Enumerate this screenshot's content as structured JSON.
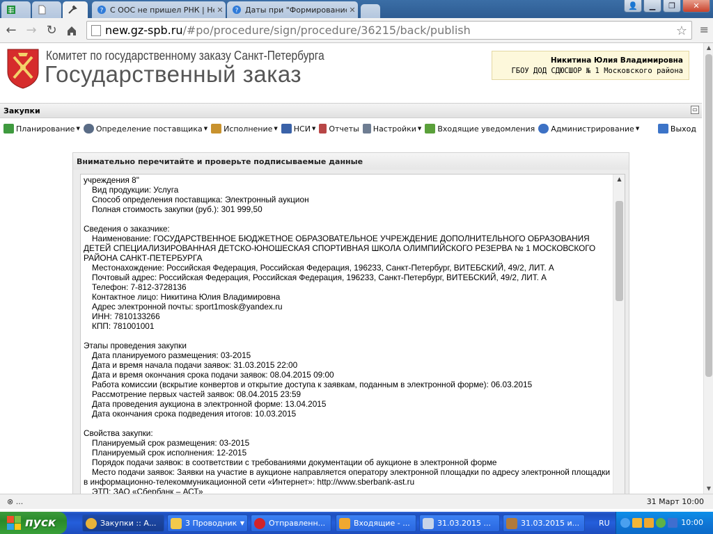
{
  "browser": {
    "tabs": [
      {
        "title": "",
        "icon": "spreadsheet-icon",
        "active": false
      },
      {
        "title": "",
        "icon": "page-icon",
        "active": false
      },
      {
        "title": "",
        "icon": "tools-icon",
        "active": true
      },
      {
        "title": "С ООС не пришел РНК | Hel",
        "icon": "help-icon",
        "active": false
      },
      {
        "title": "Даты при \"Формирование И",
        "icon": "help-icon",
        "active": false
      }
    ],
    "url_host": "new.gz-spb.ru",
    "url_path": "/#po/procedure/sign/procedure/36215/back/publish"
  },
  "header": {
    "org_name": "Комитет по государственному заказу Санкт-Петербурга",
    "site_name": "Государственный заказ",
    "user_name": "Никитина Юлия Владимировна",
    "user_org": "ГБОУ ДОД СДЮСШОР № 1 Московского района"
  },
  "panel": {
    "title": "Закупки"
  },
  "menu": {
    "items": [
      {
        "label": "Планирование",
        "icon": "planning-icon",
        "dropdown": true,
        "color": "#3f9a3f"
      },
      {
        "label": "Определение поставщика",
        "icon": "supplier-icon",
        "dropdown": true,
        "color": "#5a6c86"
      },
      {
        "label": "Исполнение",
        "icon": "execution-icon",
        "dropdown": true,
        "color": "#c8922e"
      },
      {
        "label": "НСИ",
        "icon": "book-icon",
        "dropdown": true,
        "color": "#3a62a8"
      },
      {
        "label": "Отчеты",
        "icon": "report-icon",
        "dropdown": false,
        "color": "#b84646"
      },
      {
        "label": "Настройки",
        "icon": "wrench-icon",
        "dropdown": true,
        "color": "#6e7d92"
      },
      {
        "label": "Входящие уведомления",
        "icon": "inbox-icon",
        "dropdown": false,
        "color": "#5aa03a"
      },
      {
        "label": "Администрирование",
        "icon": "admin-icon",
        "dropdown": true,
        "color": "#3d71c4"
      }
    ],
    "logout_label": "Выход"
  },
  "dialog": {
    "title": "Внимательно перечитайте и проверьте подписываемые данные",
    "lines": [
      {
        "text": "учреждения 8\"",
        "indent": false
      },
      {
        "text": "Вид продукции: Услуга",
        "indent": true
      },
      {
        "text": "Способ определения поставщика: Электронный аукцион",
        "indent": true
      },
      {
        "text": "Полная стоимость закупки (руб.): 301 999,50",
        "indent": true
      },
      {
        "text": "",
        "indent": false
      },
      {
        "text": "Сведения о заказчике:",
        "indent": false
      },
      {
        "text": "Наименование: ГОСУДАРСТВЕННОЕ БЮДЖЕТНОЕ ОБРАЗОВАТЕЛЬНОЕ УЧРЕЖДЕНИЕ ДОПОЛНИТЕЛЬНОГО ОБРАЗОВАНИЯ ДЕТЕЙ СПЕЦИАЛИЗИРОВАННАЯ ДЕТСКО-ЮНОШЕСКАЯ СПОРТИВНАЯ ШКОЛА ОЛИМПИЙСКОГО РЕЗЕРВА № 1 МОСКОВСКОГО РАЙОНА САНКТ-ПЕТЕРБУРГА",
        "indent": true,
        "wrap": true
      },
      {
        "text": "Местонахождение: Российская Федерация, Российская Федерация, 196233, Санкт-Петербург, ВИТЕБСКИЙ, 49/2, ЛИТ. А",
        "indent": true
      },
      {
        "text": "Почтовый адрес: Российская Федерация, Российская Федерация, 196233, Санкт-Петербург, ВИТЕБСКИЙ, 49/2, ЛИТ. А",
        "indent": true
      },
      {
        "text": "Телефон: 7-812-3728136",
        "indent": true
      },
      {
        "text": "Контактное лицо: Никитина Юлия Владимировна",
        "indent": true
      },
      {
        "text": "Адрес электронной почты: sport1mosk@yandex.ru",
        "indent": true
      },
      {
        "text": "ИНН: 7810133266",
        "indent": true
      },
      {
        "text": "КПП: 781001001",
        "indent": true
      },
      {
        "text": "",
        "indent": false
      },
      {
        "text": "Этапы проведения закупки",
        "indent": false
      },
      {
        "text": "Дата планируемого размещения: 03-2015",
        "indent": true
      },
      {
        "text": "Дата и время начала подачи заявок: 31.03.2015 22:00",
        "indent": true
      },
      {
        "text": "Дата и время окончания срока подачи заявок: 08.04.2015 09:00",
        "indent": true
      },
      {
        "text": "Работа комиссии (вскрытие конвертов и открытие доступа к заявкам, поданным в электронной форме): 06.03.2015",
        "indent": true
      },
      {
        "text": "Рассмотрение первых частей заявок: 08.04.2015 23:59",
        "indent": true
      },
      {
        "text": "Дата проведения аукциона в электронной форме: 13.04.2015",
        "indent": true
      },
      {
        "text": "Дата окончания срока подведения итогов: 10.03.2015",
        "indent": true
      },
      {
        "text": "",
        "indent": false
      },
      {
        "text": "Свойства закупки:",
        "indent": false
      },
      {
        "text": "Планируемый срок размещения: 03-2015",
        "indent": true
      },
      {
        "text": "Планируемый срок исполнения: 12-2015",
        "indent": true
      },
      {
        "text": "Порядок подачи заявок: в соответствии с требованиями документации об аукционе в электронной форме",
        "indent": true
      },
      {
        "text": "Место подачи заявок: Заявки на участие в аукционе направляется оператору электронной площадки по адресу электронной площадки в информационно-телекоммуникационной сети «Интернет»: http://www.sberbank-ast.ru",
        "indent": true,
        "wrap": true
      },
      {
        "text": "ЭТП: ЗАО «Сбербанк – АСТ»",
        "indent": true
      }
    ]
  },
  "statusbar": {
    "left": "⊗ ...",
    "right": "31 Март 10:00"
  },
  "taskbar": {
    "start_label": "пуск",
    "items": [
      {
        "label": "Закупки :: А...",
        "icon": "chrome-icon",
        "active": true,
        "color": "#e8b33a"
      },
      {
        "label": "3 Проводник",
        "icon": "folder-icon",
        "active": false,
        "group": true,
        "color": "#f2c94c"
      },
      {
        "label": "Отправленн...",
        "icon": "opera-icon",
        "active": false,
        "color": "#d2232a"
      },
      {
        "label": "Входящие - ...",
        "icon": "mail-icon",
        "active": false,
        "color": "#f0a830"
      },
      {
        "label": "31.03.2015 ...",
        "icon": "document-icon",
        "active": false,
        "color": "#c8d4e8"
      },
      {
        "label": "31.03.2015 и...",
        "icon": "archive-icon",
        "active": false,
        "color": "#b07a3c"
      }
    ],
    "lang": "RU",
    "clock": "10:00"
  }
}
